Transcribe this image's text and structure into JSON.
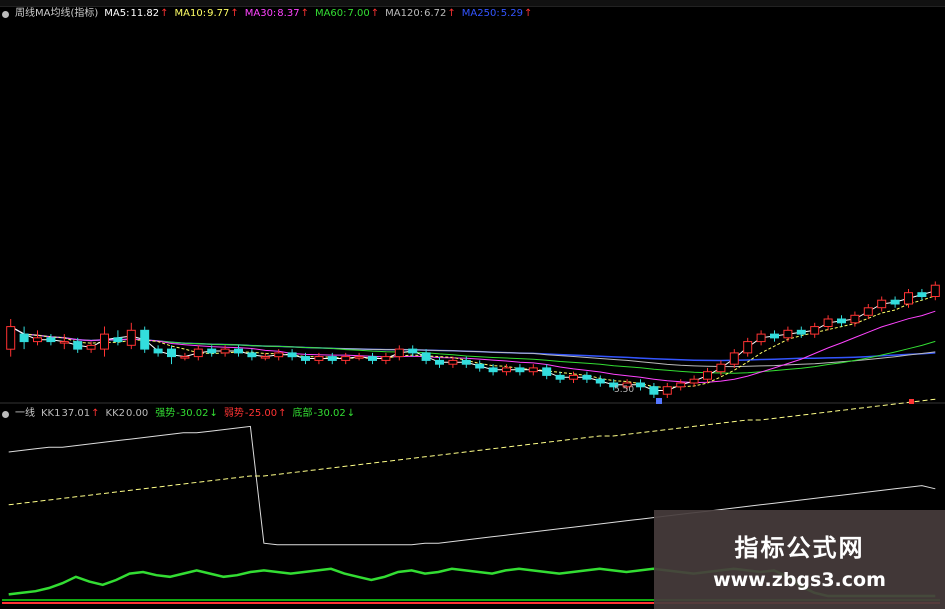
{
  "main_legend": {
    "title": "周线MA均线(指标)",
    "items": [
      {
        "label": "MA5:",
        "value": "11.82",
        "color": "#ffffff",
        "arrow": "↑"
      },
      {
        "label": "MA10:",
        "value": "9.77",
        "color": "#ffff66",
        "arrow": "↑"
      },
      {
        "label": "MA30:",
        "value": "8.37",
        "color": "#ff44ff",
        "arrow": "↑"
      },
      {
        "label": "MA60:",
        "value": "7.00",
        "color": "#33dd33",
        "arrow": "↑"
      },
      {
        "label": "MA120:",
        "value": "6.72",
        "color": "#bbbbbb",
        "arrow": "↑"
      },
      {
        "label": "MA250:",
        "value": "5.29",
        "color": "#3355ff",
        "arrow": "↑"
      }
    ]
  },
  "sub_legend": {
    "title": "一线",
    "items": [
      {
        "label": "KK1",
        "value": "37.01",
        "color": "#bbbbbb",
        "arrow": "↑"
      },
      {
        "label": "KK2",
        "value": "0.00",
        "color": "#bbbbbb",
        "arrow": ""
      },
      {
        "label": "强势",
        "value": "-30.02",
        "color": "#33dd33",
        "arrow": "↓"
      },
      {
        "label": "弱势",
        "value": "-25.00",
        "color": "#ff3333",
        "arrow": "↑"
      },
      {
        "label": "底部",
        "value": "-30.02",
        "color": "#33dd33",
        "arrow": "↓"
      }
    ]
  },
  "low_label": "5.50",
  "watermark": {
    "title": "指标公式网",
    "url": "www.zbgs3.com"
  },
  "colors": {
    "up": "#ff3333",
    "down": "#33dddd",
    "ma5": "#ffffff",
    "ma10": "#ffff66",
    "ma30": "#ff44ff",
    "ma60": "#33dd33",
    "ma120": "#bbbbbb",
    "ma250": "#3355ff",
    "kk1": "#dddddd",
    "kk2": "#ffff88",
    "strong": "#33dd33",
    "weak": "#ff3333",
    "bottom": "#11aa11"
  },
  "chart_data": [
    {
      "type": "candlestick",
      "ylim": [
        4.5,
        14.5
      ],
      "candles": [
        [
          5.8,
          6.4,
          5.6,
          6.6
        ],
        [
          6.2,
          6.0,
          5.8,
          6.4
        ],
        [
          6.0,
          6.1,
          5.9,
          6.3
        ],
        [
          6.1,
          6.0,
          5.9,
          6.2
        ],
        [
          6.0,
          6.0,
          5.8,
          6.2
        ],
        [
          6.0,
          5.8,
          5.7,
          6.1
        ],
        [
          5.8,
          5.9,
          5.7,
          6.0
        ],
        [
          5.8,
          6.2,
          5.6,
          6.4
        ],
        [
          6.1,
          6.0,
          5.9,
          6.3
        ],
        [
          5.9,
          6.3,
          5.8,
          6.5
        ],
        [
          6.3,
          5.8,
          5.7,
          6.4
        ],
        [
          5.8,
          5.7,
          5.6,
          5.9
        ],
        [
          5.8,
          5.6,
          5.4,
          5.9
        ],
        [
          5.6,
          5.6,
          5.5,
          5.7
        ],
        [
          5.6,
          5.8,
          5.5,
          5.9
        ],
        [
          5.8,
          5.7,
          5.6,
          5.9
        ],
        [
          5.7,
          5.8,
          5.6,
          5.9
        ],
        [
          5.8,
          5.7,
          5.6,
          5.9
        ],
        [
          5.7,
          5.6,
          5.5,
          5.8
        ],
        [
          5.6,
          5.6,
          5.5,
          5.7
        ],
        [
          5.6,
          5.7,
          5.5,
          5.8
        ],
        [
          5.7,
          5.6,
          5.5,
          5.8
        ],
        [
          5.6,
          5.5,
          5.4,
          5.7
        ],
        [
          5.5,
          5.6,
          5.4,
          5.7
        ],
        [
          5.6,
          5.5,
          5.4,
          5.7
        ],
        [
          5.5,
          5.6,
          5.4,
          5.7
        ],
        [
          5.6,
          5.6,
          5.5,
          5.7
        ],
        [
          5.6,
          5.5,
          5.4,
          5.7
        ],
        [
          5.5,
          5.6,
          5.4,
          5.7
        ],
        [
          5.6,
          5.8,
          5.5,
          5.9
        ],
        [
          5.8,
          5.7,
          5.6,
          5.9
        ],
        [
          5.7,
          5.5,
          5.4,
          5.8
        ],
        [
          5.5,
          5.4,
          5.3,
          5.6
        ],
        [
          5.4,
          5.5,
          5.3,
          5.6
        ],
        [
          5.5,
          5.4,
          5.3,
          5.6
        ],
        [
          5.4,
          5.3,
          5.2,
          5.5
        ],
        [
          5.3,
          5.2,
          5.1,
          5.4
        ],
        [
          5.2,
          5.3,
          5.1,
          5.4
        ],
        [
          5.3,
          5.2,
          5.1,
          5.4
        ],
        [
          5.2,
          5.3,
          5.1,
          5.4
        ],
        [
          5.3,
          5.1,
          5.0,
          5.4
        ],
        [
          5.1,
          5.0,
          4.9,
          5.2
        ],
        [
          5.0,
          5.1,
          4.9,
          5.2
        ],
        [
          5.1,
          5.0,
          4.9,
          5.2
        ],
        [
          5.0,
          4.9,
          4.8,
          5.1
        ],
        [
          4.9,
          4.8,
          4.7,
          5.0
        ],
        [
          4.8,
          4.9,
          4.7,
          5.0
        ],
        [
          4.9,
          4.8,
          4.7,
          5.0
        ],
        [
          4.8,
          4.6,
          4.5,
          4.9
        ],
        [
          4.6,
          4.8,
          4.5,
          4.9
        ],
        [
          4.8,
          4.9,
          4.7,
          5.0
        ],
        [
          4.9,
          5.0,
          4.8,
          5.1
        ],
        [
          5.0,
          5.2,
          4.9,
          5.3
        ],
        [
          5.2,
          5.4,
          5.1,
          5.5
        ],
        [
          5.4,
          5.7,
          5.3,
          5.8
        ],
        [
          5.7,
          6.0,
          5.6,
          6.1
        ],
        [
          6.0,
          6.2,
          5.9,
          6.3
        ],
        [
          6.2,
          6.1,
          6.0,
          6.3
        ],
        [
          6.1,
          6.3,
          6.0,
          6.4
        ],
        [
          6.3,
          6.2,
          6.1,
          6.4
        ],
        [
          6.2,
          6.4,
          6.1,
          6.5
        ],
        [
          6.4,
          6.6,
          6.3,
          6.7
        ],
        [
          6.6,
          6.5,
          6.4,
          6.7
        ],
        [
          6.5,
          6.7,
          6.4,
          6.8
        ],
        [
          6.7,
          6.9,
          6.6,
          7.0
        ],
        [
          6.9,
          7.1,
          6.8,
          7.2
        ],
        [
          7.1,
          7.0,
          6.9,
          7.2
        ],
        [
          7.0,
          7.3,
          6.9,
          7.4
        ],
        [
          7.3,
          7.2,
          7.1,
          7.4
        ],
        [
          7.2,
          7.5,
          7.1,
          7.6
        ]
      ]
    },
    {
      "type": "line",
      "ylim": [
        -35,
        80
      ],
      "series": [
        {
          "name": "KK1",
          "values": [
            60,
            61,
            62,
            63,
            63,
            64,
            65,
            66,
            67,
            68,
            69,
            70,
            71,
            72,
            72,
            73,
            74,
            75,
            76,
            3,
            2,
            2,
            2,
            2,
            2,
            2,
            2,
            2,
            2,
            2,
            2,
            3,
            3,
            4,
            5,
            6,
            7,
            8,
            9,
            10,
            11,
            12,
            13,
            14,
            15,
            16,
            17,
            18,
            19,
            20,
            21,
            22,
            23,
            24,
            25,
            26,
            27,
            28,
            29,
            30,
            31,
            32,
            33,
            34,
            35,
            36,
            37,
            38,
            39,
            37
          ]
        },
        {
          "name": "KK2",
          "values": [
            27,
            28,
            29,
            30,
            31,
            32,
            33,
            34,
            35,
            36,
            37,
            38,
            39,
            40,
            41,
            42,
            43,
            44,
            45,
            45,
            46,
            47,
            48,
            49,
            50,
            51,
            52,
            53,
            54,
            55,
            56,
            57,
            58,
            59,
            60,
            61,
            62,
            63,
            64,
            65,
            66,
            67,
            68,
            69,
            70,
            70,
            71,
            72,
            73,
            74,
            75,
            76,
            77,
            78,
            79,
            80,
            80,
            81,
            82,
            83,
            84,
            85,
            86,
            87,
            88,
            89,
            90,
            91,
            92,
            93
          ]
        },
        {
          "name": "强势",
          "values": [
            -29,
            -28,
            -27,
            -25,
            -22,
            -18,
            -21,
            -23,
            -20,
            -16,
            -15,
            -17,
            -18,
            -16,
            -14,
            -16,
            -18,
            -17,
            -15,
            -14,
            -15,
            -16,
            -15,
            -14,
            -13,
            -16,
            -18,
            -20,
            -18,
            -15,
            -14,
            -16,
            -15,
            -13,
            -14,
            -15,
            -16,
            -14,
            -13,
            -14,
            -15,
            -16,
            -15,
            -14,
            -13,
            -14,
            -15,
            -14,
            -13,
            -14,
            -15,
            -16,
            -15,
            -14,
            -13,
            -14,
            -15,
            -14,
            -18,
            -24,
            -28,
            -30,
            -30,
            -30,
            -30,
            -30,
            -30,
            -30,
            -30,
            -30
          ]
        }
      ]
    }
  ]
}
